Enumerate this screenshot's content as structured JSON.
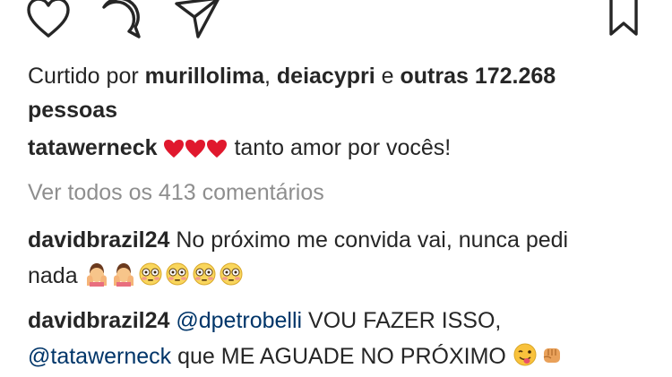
{
  "actions": {
    "icons": [
      "heart-icon",
      "comment-icon",
      "share-icon",
      "bookmark-icon"
    ]
  },
  "likes": {
    "prefix": "Curtido por ",
    "user1": "murillolima",
    "separator": ", ",
    "user2": "deiacypri",
    "conjunction": " e ",
    "others": "outras 172.268",
    "suffix": "pessoas"
  },
  "caption": {
    "username": "tatawerneck",
    "text": " tanto amor por vocês!",
    "emoji": [
      "red-heart-emoji",
      "red-heart-emoji",
      "red-heart-emoji"
    ]
  },
  "view_all_comments": "Ver todos os 413 comentários",
  "comments": [
    {
      "username": "davidbrazil24",
      "text_line1": " No próximo me convida vai, nunca pedi",
      "text_line2": "nada ",
      "emoji": [
        "person-facepalm-emoji",
        "person-facepalm-emoji",
        "flushed-face-emoji",
        "flushed-face-emoji",
        "flushed-face-emoji",
        "flushed-face-emoji"
      ]
    },
    {
      "username": "davidbrazil24",
      "mention1": "@dpetrobelli",
      "text_line1": "  VOU FAZER ISSO,",
      "mention2": "@tatawerneck",
      "text_line2": " que ME AGUADE NO PRÓXIMO ",
      "emoji": [
        "winking-tongue-emoji",
        "fist-bump-emoji"
      ]
    }
  ]
}
